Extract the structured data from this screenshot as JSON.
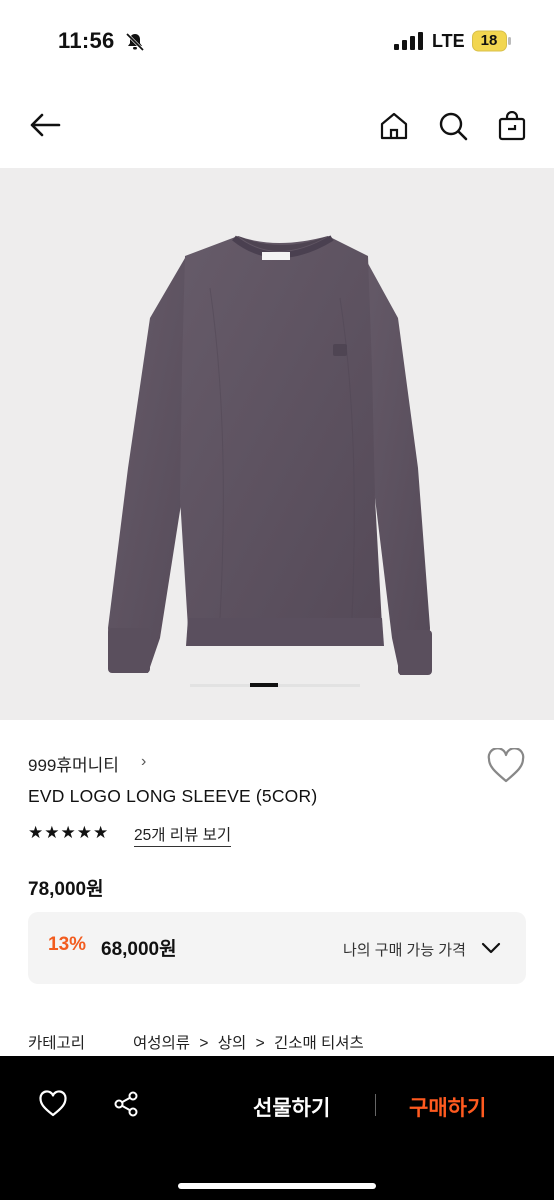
{
  "status_bar": {
    "time": "11:56",
    "network": "LTE",
    "battery": "18",
    "icons": [
      "bell-slash-icon",
      "signal-icon",
      "battery-icon"
    ]
  },
  "nav": {
    "icons": [
      "back-arrow-icon",
      "home-icon",
      "search-icon",
      "shopping-bag-icon"
    ]
  },
  "product": {
    "brand": "999휴머니티",
    "brand_chevron": "›",
    "name": "EVD LOGO LONG SLEEVE (5COR)",
    "rating_stars": "★★★★★",
    "rating": 5,
    "review_link": "25개 리뷰 보기",
    "price": "78,000원",
    "image_index": 1,
    "image_count": 6,
    "shirt_color": "#5c5260"
  },
  "discount": {
    "percent": "13%",
    "price": "68,000원",
    "label": "나의 구매 가능 가격"
  },
  "category": {
    "label": "카테고리",
    "path": [
      "여성의류",
      "상의",
      "긴소매 티셔츠"
    ],
    "separator": ">"
  },
  "bottom_bar": {
    "gift_label": "선물하기",
    "buy_label": "구매하기",
    "icons": [
      "heart-icon",
      "share-icon"
    ],
    "accent_color": "#ff5a1f"
  }
}
